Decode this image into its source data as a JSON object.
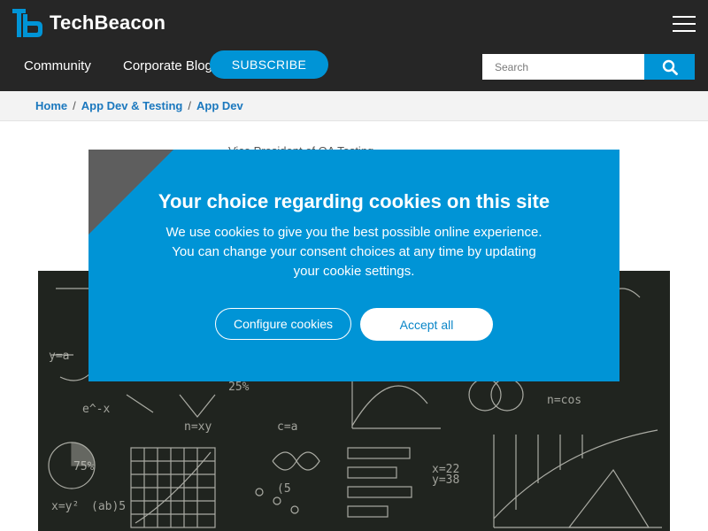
{
  "header": {
    "logo_text": "TechBeacon",
    "nav": {
      "community": "Community",
      "corporate_blog": "Corporate Blog",
      "subscribe": "SUBSCRIBE"
    },
    "search": {
      "placeholder": "Search",
      "value": ""
    },
    "icons": [
      "techbeacon-logo-icon",
      "hamburger-menu-icon",
      "search-icon"
    ]
  },
  "breadcrumb": {
    "items": [
      "Home",
      "App Dev & Testing",
      "App Dev"
    ],
    "separator": "/"
  },
  "article": {
    "category_partial": "Vice President of QA Testing"
  },
  "cookie_modal": {
    "title": "Your choice regarding cookies on this site",
    "body_line1": "We use cookies to give you the best possible online experience.",
    "body_line2": "You can change your consent choices at any time by updating",
    "body_line3": "your cookie settings.",
    "configure_label": "Configure cookies",
    "accept_label": "Accept all"
  },
  "colors": {
    "header_bg": "#262626",
    "accent_blue": "#0094d6",
    "link_blue": "#1b78be",
    "breadcrumb_bg": "#f3f3f3",
    "modal_bg": "#0094d6",
    "white": "#ffffff"
  }
}
